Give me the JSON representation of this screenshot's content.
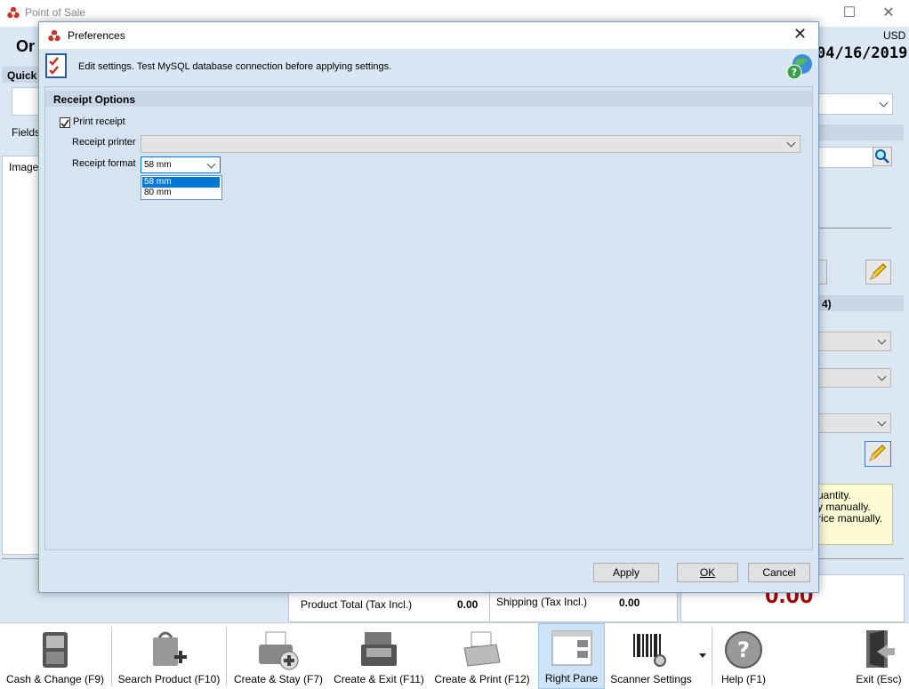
{
  "app": {
    "title": "Point of Sale",
    "currency": "USD",
    "date": "04/16/2019",
    "heading_fragment": "Or",
    "left_panel": {
      "quick_label": "Quick",
      "fields_label": "Fields",
      "image_label": "Image"
    },
    "right_panel": {
      "section_fragment": "4)",
      "hint_lines": [
        "uantity.",
        "y manually.",
        "rice manually."
      ]
    },
    "totals": {
      "product_total_label": "Product Total (Tax Incl.)",
      "product_total_value": "0.00",
      "shipping_label": "Shipping (Tax Incl.)",
      "shipping_value": "0.00",
      "grand_total_fragment": "0.00"
    }
  },
  "toolbar": {
    "items": [
      {
        "label": "Cash & Change (F9)",
        "icon": "cash-register-drawer-icon"
      },
      {
        "label": "Search Product (F10)",
        "icon": "shopping-bag-add-icon"
      },
      {
        "label": "Create & Stay (F7)",
        "icon": "printer-add-icon"
      },
      {
        "label": "Create & Exit (F11)",
        "icon": "cash-register-icon"
      },
      {
        "label": "Create & Print (F12)",
        "icon": "printer-icon"
      },
      {
        "label": "Right Pane",
        "icon": "right-pane-icon",
        "active": true
      },
      {
        "label": "Scanner Settings",
        "icon": "barcode-gear-icon"
      },
      {
        "label": "Help (F1)",
        "icon": "help-icon"
      },
      {
        "label": "Exit (Esc)",
        "icon": "exit-door-icon"
      }
    ]
  },
  "dialog": {
    "title": "Preferences",
    "description": "Edit settings. Test MySQL database connection before applying settings.",
    "section_title": "Receipt Options",
    "print_receipt": {
      "label": "Print receipt",
      "checked": true
    },
    "receipt_printer": {
      "label": "Receipt printer",
      "value": ""
    },
    "receipt_format": {
      "label": "Receipt format",
      "value": "58 mm",
      "options": [
        "58 mm",
        "80 mm"
      ],
      "highlighted": "58 mm"
    },
    "buttons": {
      "apply": "Apply",
      "ok": "OK",
      "cancel": "Cancel"
    }
  },
  "colors": {
    "accent": "#0078d7",
    "total_red": "#a00000",
    "dialog_bg": "#d9e6f3"
  }
}
